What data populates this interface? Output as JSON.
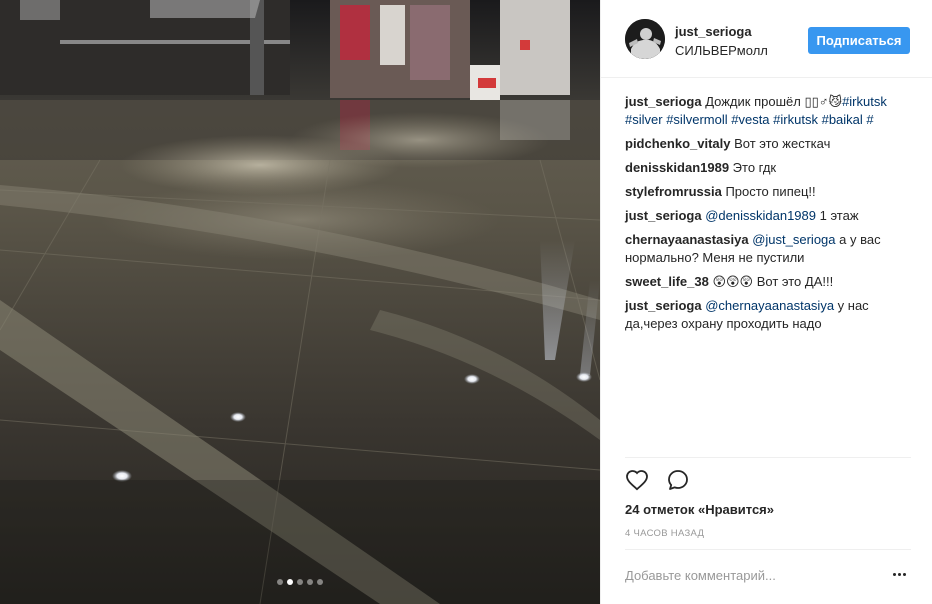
{
  "post": {
    "username": "just_serioga",
    "location": "СИЛЬВЕРмолл",
    "follow_label": "Подписаться",
    "carousel": {
      "count": 5,
      "active_index": 1
    }
  },
  "comments": [
    {
      "parts": [
        {
          "type": "author",
          "text": "just_serioga"
        },
        {
          "type": "text",
          "text": " Дождик прошёл ▯▯♂😼"
        },
        {
          "type": "tag",
          "text": "#irkutsk"
        },
        {
          "type": "text",
          "text": " "
        },
        {
          "type": "tag",
          "text": "#silver"
        },
        {
          "type": "text",
          "text": " "
        },
        {
          "type": "tag",
          "text": "#silvermoll"
        },
        {
          "type": "text",
          "text": " "
        },
        {
          "type": "tag",
          "text": "#vesta"
        },
        {
          "type": "text",
          "text": " "
        },
        {
          "type": "tag",
          "text": "#irkutsk"
        },
        {
          "type": "text",
          "text": " "
        },
        {
          "type": "tag",
          "text": "#baikal"
        },
        {
          "type": "text",
          "text": " "
        },
        {
          "type": "tag",
          "text": "#"
        }
      ]
    },
    {
      "parts": [
        {
          "type": "author",
          "text": "pidchenko_vitaly"
        },
        {
          "type": "text",
          "text": " Вот это жесткач"
        }
      ]
    },
    {
      "parts": [
        {
          "type": "author",
          "text": "denisskidan1989"
        },
        {
          "type": "text",
          "text": " Это гдк"
        }
      ]
    },
    {
      "parts": [
        {
          "type": "author",
          "text": "stylefromrussia"
        },
        {
          "type": "text",
          "text": " Просто пипец!!"
        }
      ]
    },
    {
      "parts": [
        {
          "type": "author",
          "text": "just_serioga"
        },
        {
          "type": "text",
          "text": " "
        },
        {
          "type": "mention",
          "text": "@denisskidan1989"
        },
        {
          "type": "text",
          "text": " 1 этаж"
        }
      ]
    },
    {
      "parts": [
        {
          "type": "author",
          "text": "chernayaanastasiya"
        },
        {
          "type": "text",
          "text": " "
        },
        {
          "type": "mention",
          "text": "@just_serioga"
        },
        {
          "type": "text",
          "text": " а у вас нормально? Меня не пустили"
        }
      ]
    },
    {
      "parts": [
        {
          "type": "author",
          "text": "sweet_life_38"
        },
        {
          "type": "text",
          "text": " 😲😲😲 Вот это ДА!!!"
        }
      ]
    },
    {
      "parts": [
        {
          "type": "author",
          "text": "just_serioga"
        },
        {
          "type": "text",
          "text": " "
        },
        {
          "type": "mention",
          "text": "@chernayaanastasiya"
        },
        {
          "type": "text",
          "text": " у нас да,через охрану проходить надо"
        }
      ]
    }
  ],
  "actions": {
    "like_icon": "heart-icon",
    "comment_icon": "speech-bubble-icon",
    "likes_text": "24 отметок «Нравится»",
    "timestamp": "4 часов назад"
  },
  "add_comment": {
    "placeholder": "Добавьте комментарий...",
    "more_icon": "more-options-icon"
  },
  "colors": {
    "accent": "#3897f0",
    "link": "#003569",
    "muted": "#999999",
    "border": "#efefef"
  }
}
